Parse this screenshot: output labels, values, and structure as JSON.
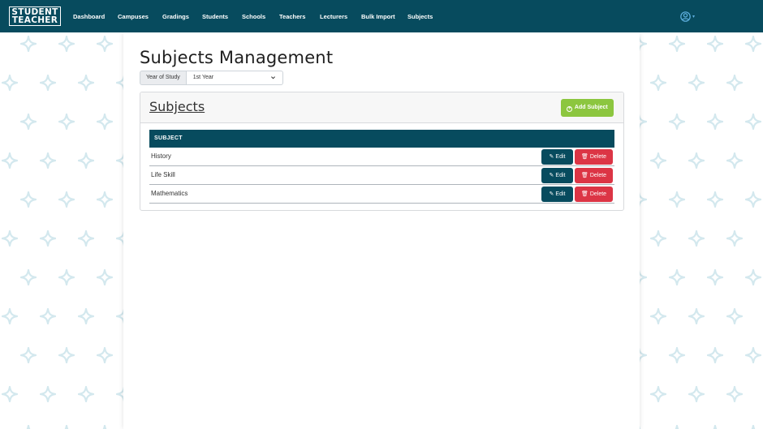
{
  "logo": {
    "line1": "STUDENT",
    "line2": "TEACHER"
  },
  "nav": {
    "items": [
      {
        "label": "Dashboard"
      },
      {
        "label": "Campuses"
      },
      {
        "label": "Gradings"
      },
      {
        "label": "Students"
      },
      {
        "label": "Schools"
      },
      {
        "label": "Teachers"
      },
      {
        "label": "Lecturers"
      },
      {
        "label": "Bulk Import"
      },
      {
        "label": "Subjects"
      }
    ],
    "user_icon": "user-circle-icon"
  },
  "page": {
    "title": "Subjects Management",
    "filter": {
      "label": "Year of Study",
      "selected": "1st Year"
    }
  },
  "card": {
    "title": "Subjects",
    "add_label": "Add Subject",
    "table": {
      "header": "SUBJECT",
      "rows": [
        {
          "name": "History",
          "edit": "Edit",
          "delete": "Delete"
        },
        {
          "name": "Life Skill",
          "edit": "Edit",
          "delete": "Delete"
        },
        {
          "name": "Mathematics",
          "edit": "Edit",
          "delete": "Delete"
        }
      ]
    }
  },
  "colors": {
    "primary": "#074b5e",
    "success": "#8cc63f",
    "danger": "#dc3545",
    "pattern": "#d6ebf0"
  }
}
